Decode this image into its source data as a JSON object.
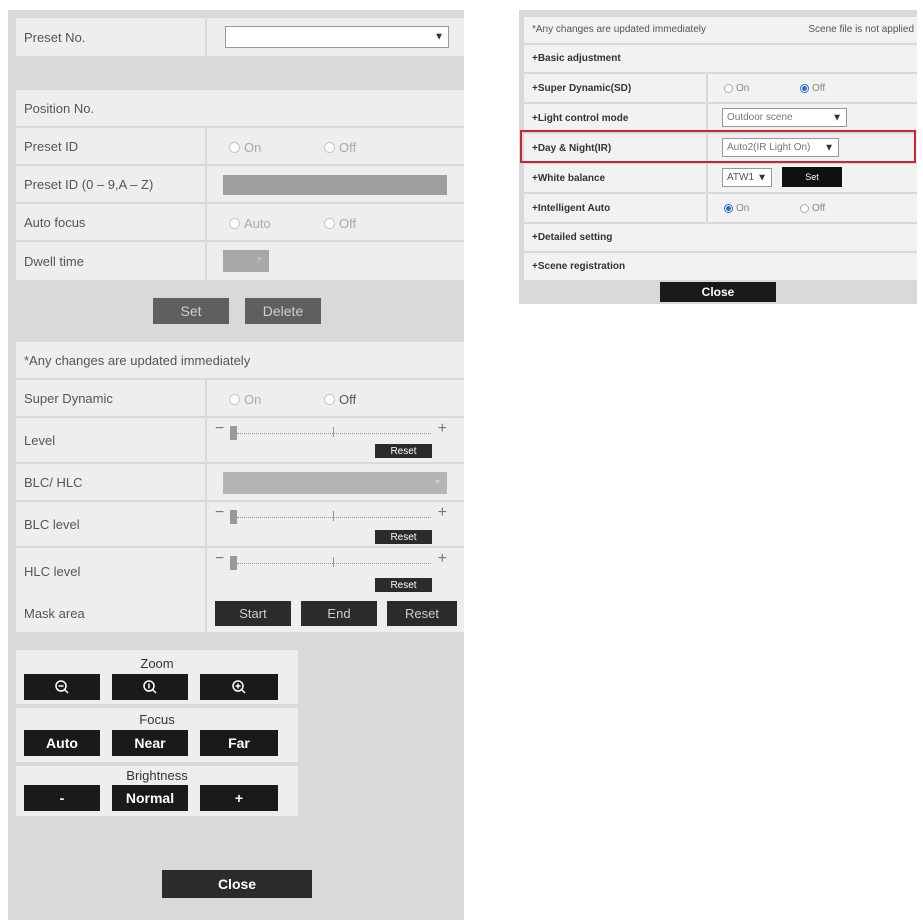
{
  "left": {
    "preset_no_label": "Preset No.",
    "preset_no_value": "",
    "position_no_label": "Position No.",
    "preset_id_label": "Preset ID",
    "preset_id_on": "On",
    "preset_id_off": "Off",
    "preset_id_text_label": "Preset ID (0 – 9,A – Z)",
    "auto_focus_label": "Auto focus",
    "auto_focus_auto": "Auto",
    "auto_focus_off": "Off",
    "dwell_time_label": "Dwell time",
    "set_button": "Set",
    "delete_button": "Delete",
    "notice": "*Any changes are updated immediately",
    "super_dynamic_label": "Super Dynamic",
    "super_dynamic_on": "On",
    "super_dynamic_off": "Off",
    "level_label": "Level",
    "blc_hlc_label": "BLC/ HLC",
    "blc_level_label": "BLC level",
    "hlc_level_label": "HLC level",
    "reset_label": "Reset",
    "mask_area_label": "Mask area",
    "mask_start": "Start",
    "mask_end": "End",
    "mask_reset": "Reset",
    "zoom_title": "Zoom",
    "focus_title": "Focus",
    "focus_auto": "Auto",
    "focus_near": "Near",
    "focus_far": "Far",
    "brightness_title": "Brightness",
    "brightness_minus": "-",
    "brightness_normal": "Normal",
    "brightness_plus": "+",
    "close_button": "Close"
  },
  "right": {
    "notice": "*Any changes are updated immediately",
    "scene_status": "Scene file is not applied",
    "basic_adjustment": "+Basic adjustment",
    "super_dynamic_label": "+Super Dynamic(SD)",
    "sd_on": "On",
    "sd_off": "Off",
    "light_control_label": "+Light control mode",
    "light_control_value": "Outdoor scene",
    "day_night_label": "+Day & Night(IR)",
    "day_night_value": "Auto2(IR Light On)",
    "white_balance_label": "+White balance",
    "white_balance_value": "ATW1",
    "wb_set": "Set",
    "intelligent_auto_label": "+Intelligent Auto",
    "ia_on": "On",
    "ia_off": "Off",
    "detailed_setting": "+Detailed setting",
    "scene_registration": "+Scene registration",
    "close_button": "Close"
  },
  "colors": {
    "highlight": "#d0252c",
    "radio_selected": "#2a6ed8",
    "panel_bg": "#d9d9d9",
    "row_bg": "#eeeeee",
    "button_dark": "#1a1a1a"
  }
}
